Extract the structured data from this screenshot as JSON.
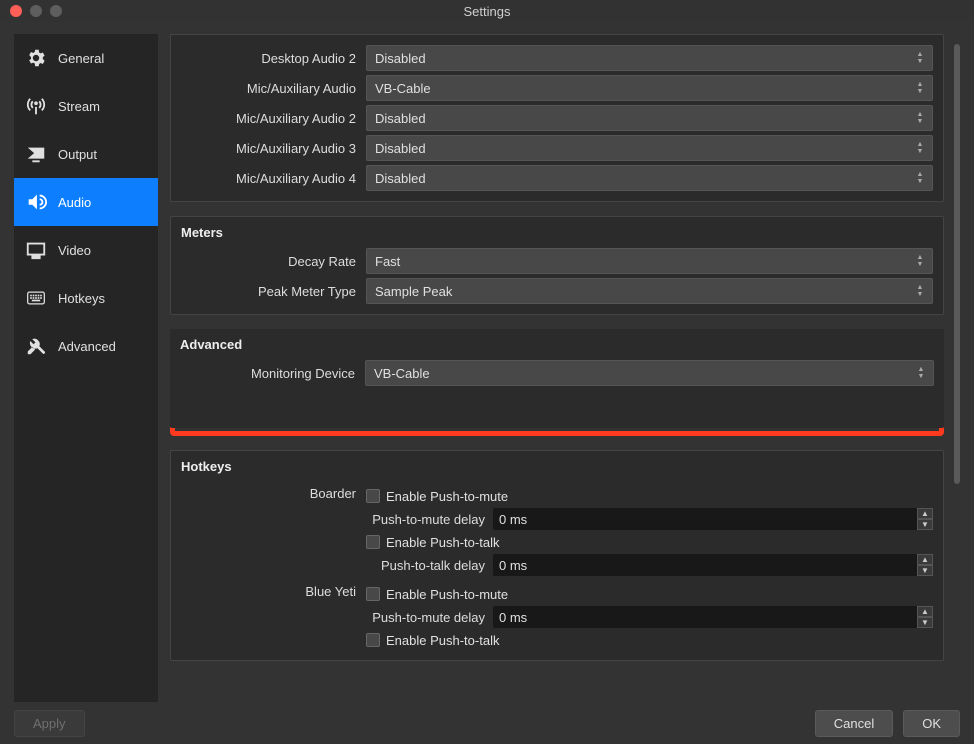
{
  "window": {
    "title": "Settings"
  },
  "sidebar": {
    "items": [
      {
        "label": "General"
      },
      {
        "label": "Stream"
      },
      {
        "label": "Output"
      },
      {
        "label": "Audio"
      },
      {
        "label": "Video"
      },
      {
        "label": "Hotkeys"
      },
      {
        "label": "Advanced"
      }
    ]
  },
  "devices": {
    "rows": [
      {
        "label": "Desktop Audio 2",
        "value": "Disabled"
      },
      {
        "label": "Mic/Auxiliary Audio",
        "value": "VB-Cable"
      },
      {
        "label": "Mic/Auxiliary Audio 2",
        "value": "Disabled"
      },
      {
        "label": "Mic/Auxiliary Audio 3",
        "value": "Disabled"
      },
      {
        "label": "Mic/Auxiliary Audio 4",
        "value": "Disabled"
      }
    ]
  },
  "meters": {
    "title": "Meters",
    "rows": [
      {
        "label": "Decay Rate",
        "value": "Fast"
      },
      {
        "label": "Peak Meter Type",
        "value": "Sample Peak"
      }
    ]
  },
  "advanced": {
    "title": "Advanced",
    "monitoring_label": "Monitoring Device",
    "monitoring_value": "VB-Cable"
  },
  "hotkeys": {
    "title": "Hotkeys",
    "labels": {
      "enable_ptm": "Enable Push-to-mute",
      "ptm_delay": "Push-to-mute delay",
      "enable_ptt": "Enable Push-to-talk",
      "ptt_delay": "Push-to-talk delay"
    },
    "zero_ms": "0 ms",
    "groups": [
      {
        "name": "Boarder"
      },
      {
        "name": "Blue Yeti"
      }
    ]
  },
  "footer": {
    "apply": "Apply",
    "cancel": "Cancel",
    "ok": "OK"
  }
}
